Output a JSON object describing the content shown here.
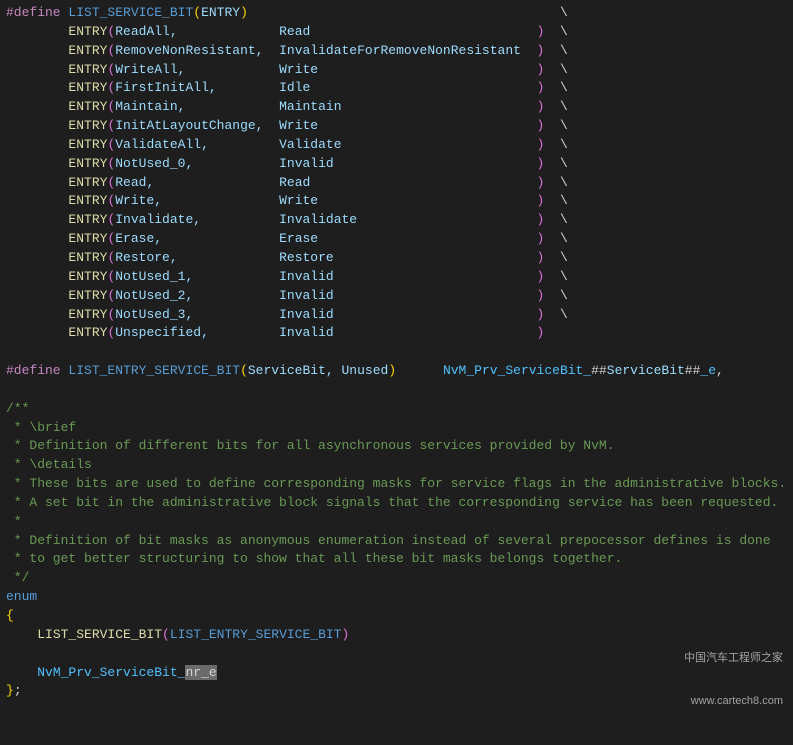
{
  "define1": {
    "directive": "#define",
    "name": "LIST_SERVICE_BIT",
    "param": "ENTRY",
    "entries": [
      {
        "a": "ReadAll,",
        "b": "Read"
      },
      {
        "a": "RemoveNonResistant,",
        "b": "InvalidateForRemoveNonResistant"
      },
      {
        "a": "WriteAll,",
        "b": "Write"
      },
      {
        "a": "FirstInitAll,",
        "b": "Idle"
      },
      {
        "a": "Maintain,",
        "b": "Maintain"
      },
      {
        "a": "InitAtLayoutChange,",
        "b": "Write"
      },
      {
        "a": "ValidateAll,",
        "b": "Validate"
      },
      {
        "a": "NotUsed_0,",
        "b": "Invalid"
      },
      {
        "a": "Read,",
        "b": "Read"
      },
      {
        "a": "Write,",
        "b": "Write"
      },
      {
        "a": "Invalidate,",
        "b": "Invalidate"
      },
      {
        "a": "Erase,",
        "b": "Erase"
      },
      {
        "a": "Restore,",
        "b": "Restore"
      },
      {
        "a": "NotUsed_1,",
        "b": "Invalid"
      },
      {
        "a": "NotUsed_2,",
        "b": "Invalid"
      },
      {
        "a": "NotUsed_3,",
        "b": "Invalid"
      },
      {
        "a": "Unspecified,",
        "b": "Invalid"
      }
    ]
  },
  "define2": {
    "directive": "#define",
    "name": "LIST_ENTRY_SERVICE_BIT",
    "params": "ServiceBit, Unused",
    "enumPrefix": "NvM_Prv_ServiceBit_",
    "hashParam": "ServiceBit",
    "enumSuffix": "_e",
    "comma": ","
  },
  "comment": {
    "open": "/**",
    "l1": " * \\brief",
    "l2": " * Definition of different bits for all asynchronous services provided by NvM.",
    "l3": " * \\details",
    "l4": " * These bits are used to define corresponding masks for service flags in the administrative blocks.",
    "l5": " * A set bit in the administrative block signals that the corresponding service has been requested.",
    "l6": " *",
    "l7": " * Definition of bit masks as anonymous enumeration instead of several prepocessor defines is done",
    "l8": " * to get better structuring to show that all these bit masks belongs together.",
    "close": " */"
  },
  "enumBlock": {
    "kw": "enum",
    "open": "{",
    "callMacro": "LIST_SERVICE_BIT",
    "callArg": "LIST_ENTRY_SERVICE_BIT",
    "lastPrefix": "NvM_Prv_ServiceBit_",
    "lastSuffix": "nr_e",
    "close": "};"
  },
  "watermark": {
    "line1": "中国汽车工程师之家",
    "line2": "www.cartech8.com"
  },
  "layout": {
    "col1Width": 25,
    "col2Target": 33
  }
}
